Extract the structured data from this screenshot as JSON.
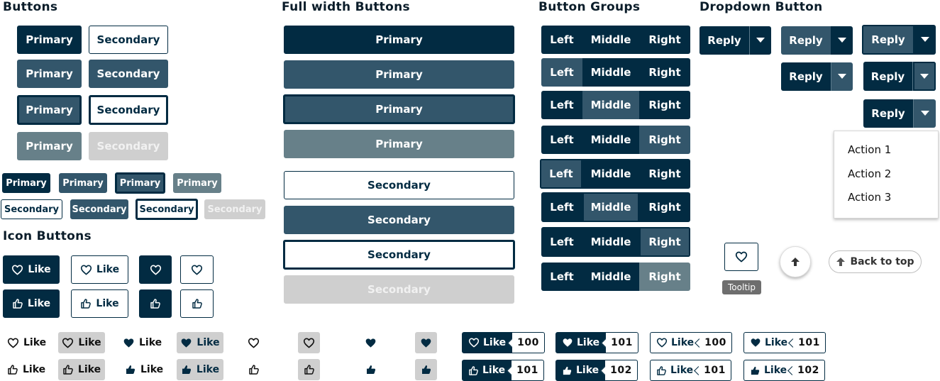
{
  "headings": {
    "buttons": "Buttons",
    "full_width": "Full width Buttons",
    "groups": "Button Groups",
    "dropdown": "Dropdown Button",
    "icon_buttons": "Icon Buttons"
  },
  "labels": {
    "primary": "Primary",
    "secondary": "Secondary",
    "like": "Like",
    "left": "Left",
    "middle": "Middle",
    "right": "Right",
    "reply": "Reply",
    "back_to_top": "Back to top",
    "tooltip": "Tooltip"
  },
  "dropdown_menu": [
    "Action 1",
    "Action 2",
    "Action 3"
  ],
  "counts": [
    "100",
    "101",
    "100",
    "101",
    "101",
    "102",
    "101",
    "102"
  ],
  "colors": {
    "dark": "#022b42",
    "medium": "#33566b",
    "light": "#678089",
    "disabled": "#cfcfcf"
  },
  "icons": [
    "heart-icon",
    "thumbs-up-icon",
    "chevron-down-icon",
    "arrow-up-icon"
  ]
}
